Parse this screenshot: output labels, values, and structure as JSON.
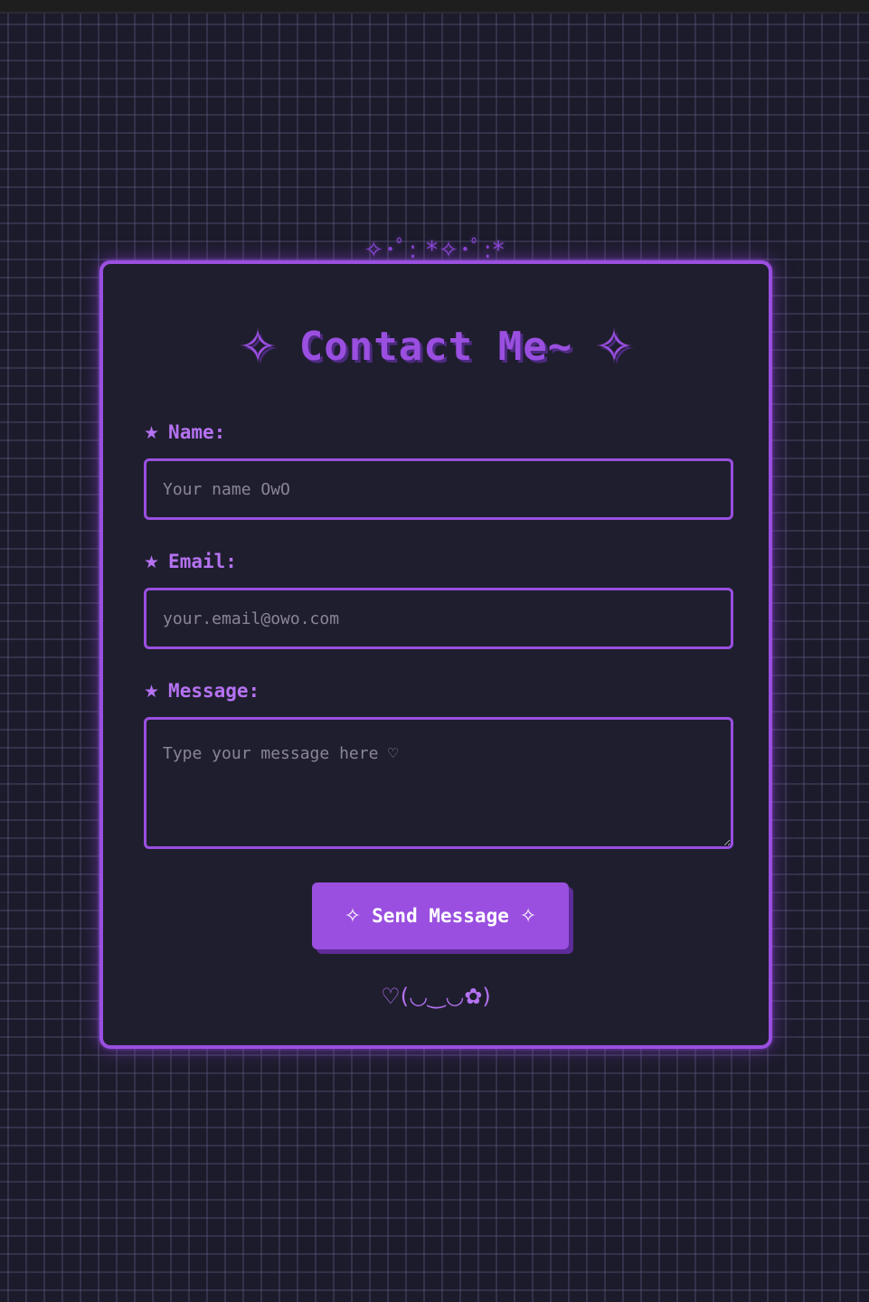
{
  "decoration": {
    "sparkle_line": "✧･ﾟ: *✧･ﾟ:*"
  },
  "form": {
    "title": "Contact Me~",
    "title_star": "✧",
    "label_star": "★",
    "fields": {
      "name": {
        "label": "Name:",
        "placeholder": "Your name OwO",
        "value": ""
      },
      "email": {
        "label": "Email:",
        "placeholder": "your.email@owo.com",
        "value": ""
      },
      "message": {
        "label": "Message:",
        "placeholder": "Type your message here ♡",
        "value": ""
      }
    },
    "submit": {
      "label": "Send Message",
      "sparkle": "✧"
    },
    "kaomoji": "♡(◡‿◡✿)"
  },
  "colors": {
    "accent": "#9a4fe0",
    "label": "#b572f2",
    "card_background": "#1f1e2e",
    "page_background": "#1c1b2b",
    "button_shadow": "#5e2c99"
  },
  "icons": {
    "title_star": "sparkle-icon",
    "label_marker": "star-icon",
    "button_decor": "sparkle-icon"
  }
}
